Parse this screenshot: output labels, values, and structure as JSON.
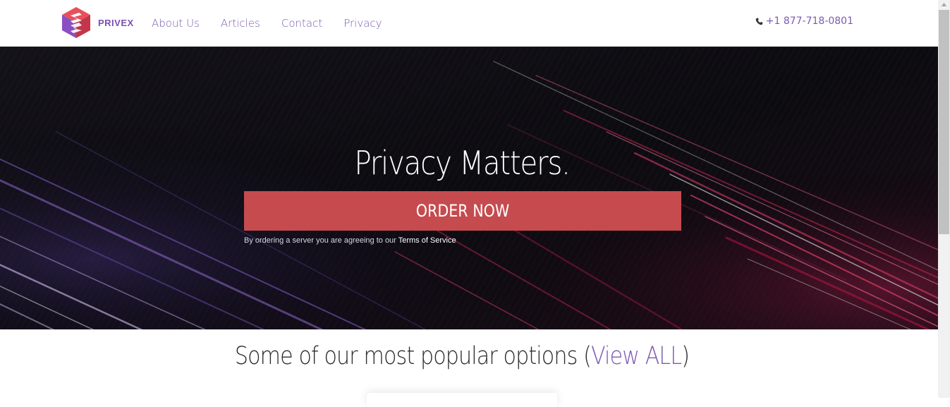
{
  "brand": {
    "name": "PRIVEX",
    "logo_icon": "privex-cube-logo-icon"
  },
  "nav": {
    "links": [
      {
        "label": "About Us"
      },
      {
        "label": "Articles"
      },
      {
        "label": "Contact"
      },
      {
        "label": "Privacy"
      }
    ],
    "phone": {
      "icon": "phone-icon",
      "number": "+1 877-718-0801"
    }
  },
  "hero": {
    "title": "Privacy Matters.",
    "cta_label": "ORDER NOW",
    "note_prefix": "By ordering a server you are agreeing to our",
    "note_link": "Terms of Service"
  },
  "popular": {
    "heading_prefix": "Some of our most popular options (",
    "view_all": "View ALL",
    "heading_suffix": ")"
  },
  "colors": {
    "accent_purple": "#7c5bb0",
    "cta_red": "#c54b4f",
    "hero_bg": "#0b0a0f"
  }
}
